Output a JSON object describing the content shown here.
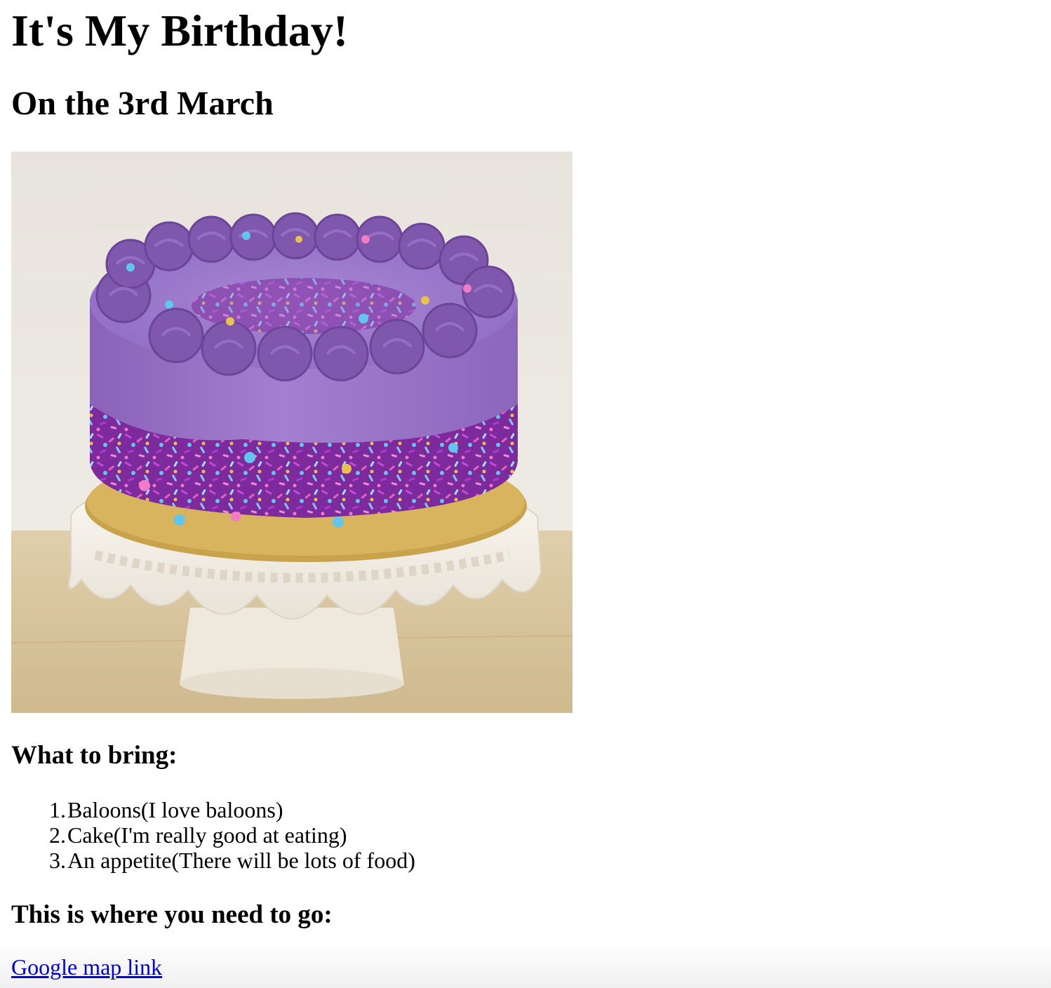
{
  "page": {
    "title": "It's My Birthday!",
    "subtitle": "On the 3rd March"
  },
  "cake": {
    "image_name": "purple-birthday-cake-image",
    "colors": {
      "background_wall": "#ece8e3",
      "table": "#dcc9a4",
      "frosting": "#9a74c8",
      "sprinkles": "#8a2aa5",
      "stand": "#f5f1ea",
      "gold_board": "#c8a24a"
    }
  },
  "bring": {
    "heading": "What to bring:",
    "items": [
      {
        "num": "1.",
        "text": "Baloons(I love baloons)"
      },
      {
        "num": "2.",
        "text": "Cake(I'm really good at eating)"
      },
      {
        "num": "3.",
        "text": "An appetite(There will be lots of food)"
      }
    ]
  },
  "directions": {
    "heading": "This is where you need to go:",
    "link_text": "Google map link",
    "link_color": "#0000ee"
  }
}
